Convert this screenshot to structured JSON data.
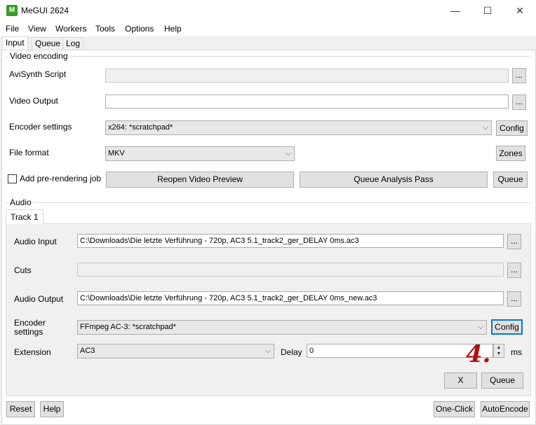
{
  "window": {
    "title": "MeGUI 2624",
    "app_icon": "megui-icon",
    "minimize": "—",
    "maximize": "☐",
    "close": "✕"
  },
  "menu": {
    "items": [
      {
        "label": "File"
      },
      {
        "label": "View"
      },
      {
        "label": "Workers"
      },
      {
        "label": "Tools"
      },
      {
        "label": "Options"
      },
      {
        "label": "Help"
      }
    ]
  },
  "tabs": [
    {
      "label": "Input",
      "active": true
    },
    {
      "label": "Queue",
      "active": false
    },
    {
      "label": "Log",
      "active": false
    }
  ],
  "video": {
    "group_label": "Video encoding",
    "avisynth_label": "AviSynth Script",
    "avisynth_value": "",
    "output_label": "Video Output",
    "output_value": "",
    "encoder_label": "Encoder settings",
    "encoder_value": "x264: *scratchpad*",
    "encoder_config": "Config",
    "format_label": "File format",
    "format_value": "MKV",
    "zones_button": "Zones",
    "prerender_label": "Add pre-rendering job",
    "prerender_checked": false,
    "reopen_button": "Reopen Video Preview",
    "analysis_button": "Queue Analysis Pass",
    "queue_button": "Queue",
    "browse": "..."
  },
  "audio": {
    "group_label": "Audio",
    "track_tab": "Track 1",
    "input_label": "Audio Input",
    "input_value": "C:\\Downloads\\Die letzte Verführung - 720p, AC3 5.1_track2_ger_DELAY 0ms.ac3",
    "cuts_label": "Cuts",
    "cuts_value": "",
    "output_label": "Audio Output",
    "output_value": "C:\\Downloads\\Die letzte Verführung - 720p, AC3 5.1_track2_ger_DELAY 0ms_new.ac3",
    "encoder_label_line1": "Encoder",
    "encoder_label_line2": "settings",
    "encoder_value": "FFmpeg AC-3: *scratchpad*",
    "encoder_config": "Config",
    "extension_label": "Extension",
    "extension_value": "AC3",
    "delay_label": "Delay",
    "delay_value": "0",
    "ms_label": "ms",
    "x_button": "X",
    "queue_button": "Queue",
    "browse": "...",
    "annotation": "4."
  },
  "footer": {
    "reset": "Reset",
    "help": "Help",
    "one_click": "One-Click",
    "auto_encode": "AutoEncode"
  },
  "colors": {
    "annotation": "#b01010",
    "focus": "#0078d7"
  }
}
